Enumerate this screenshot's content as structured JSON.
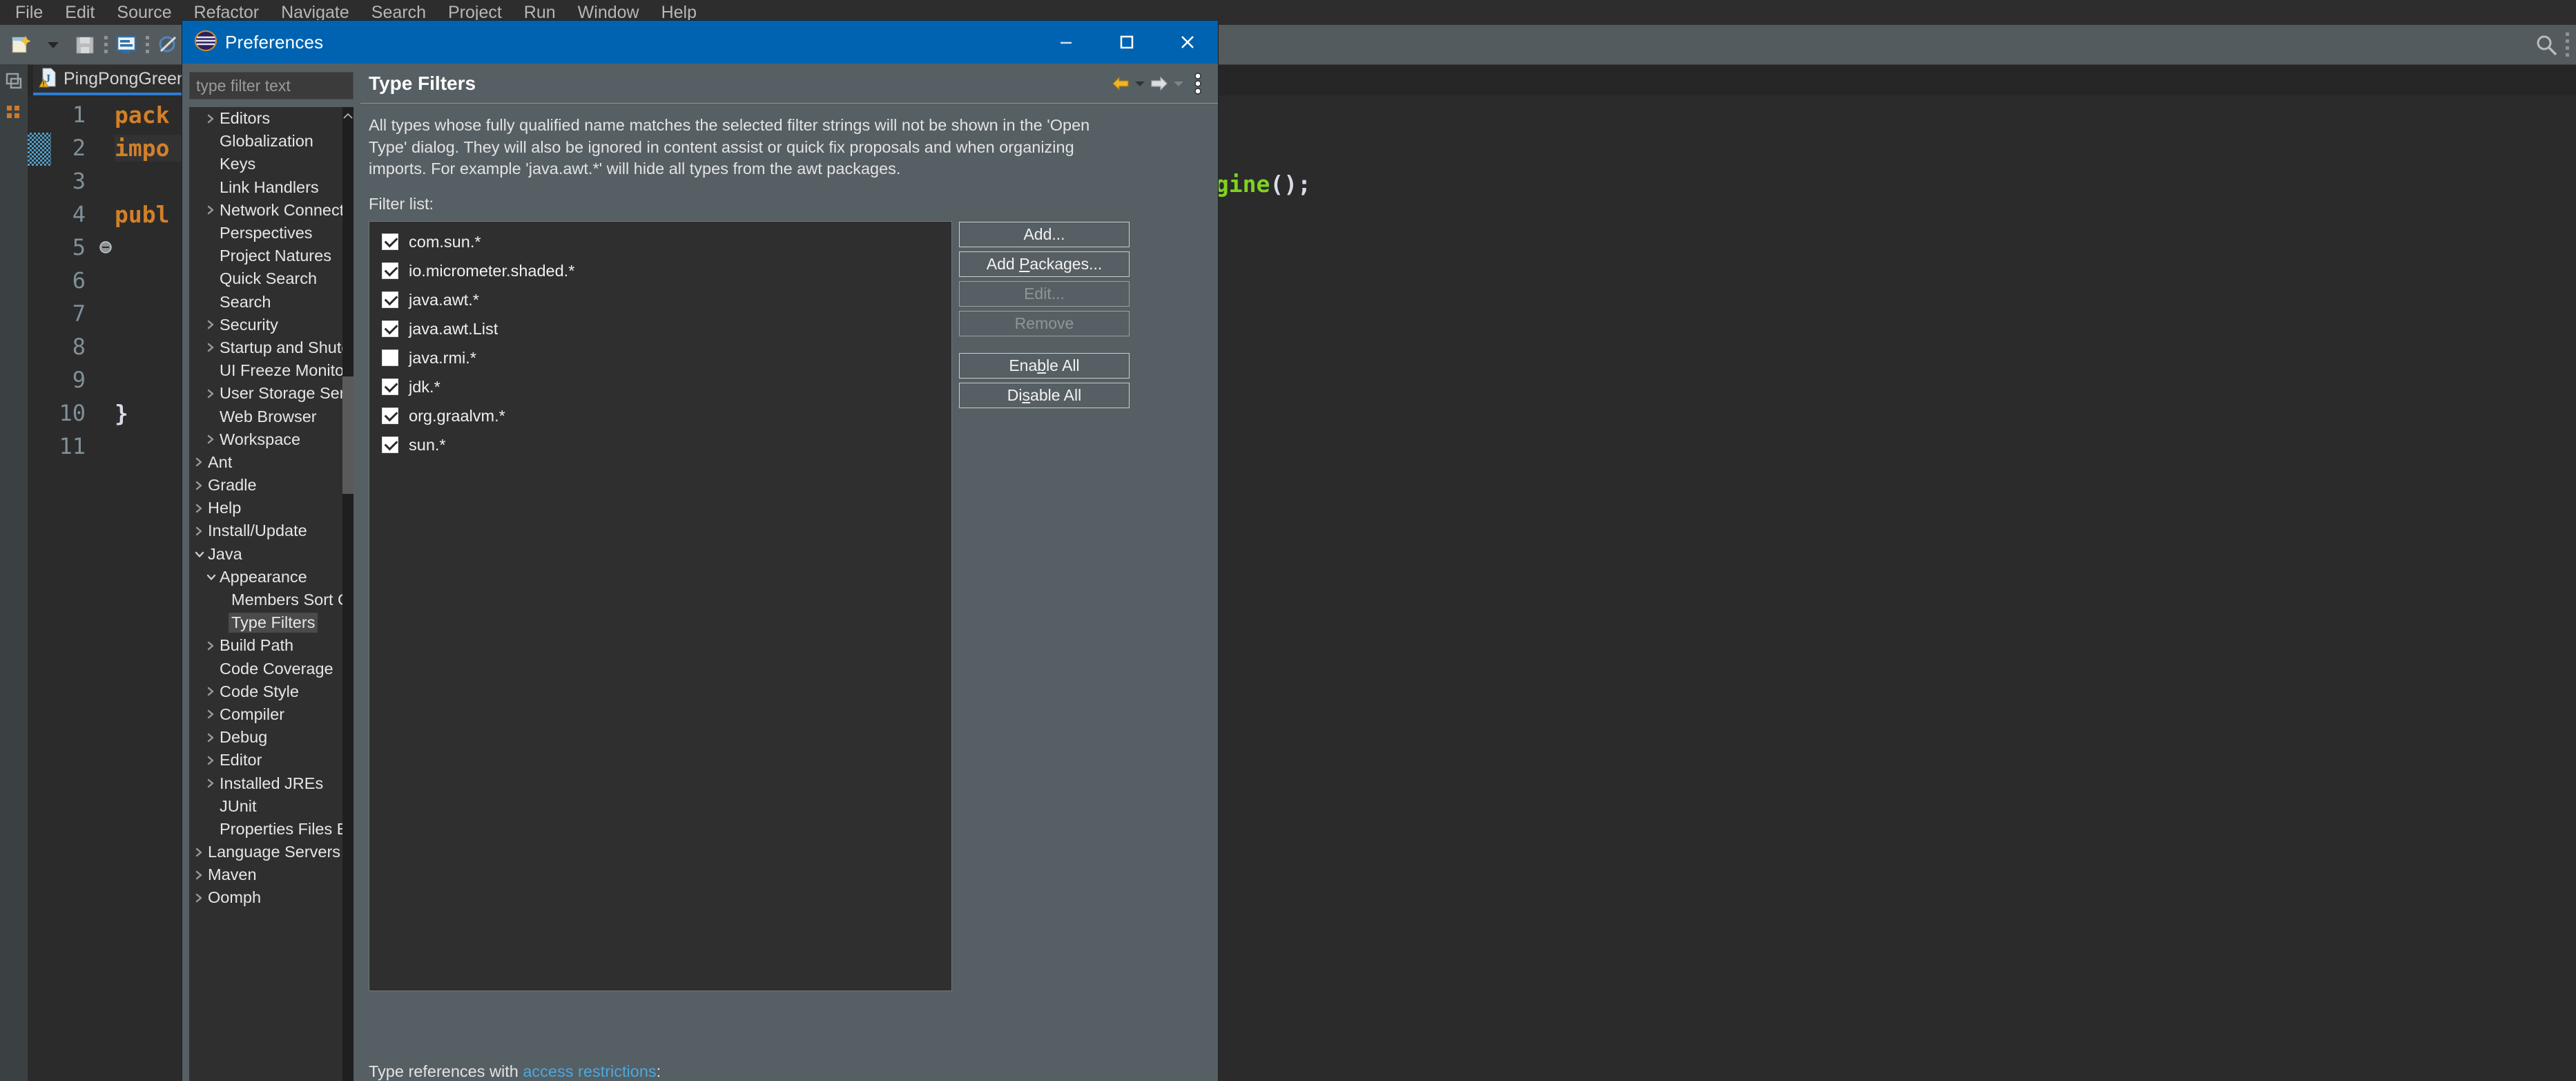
{
  "ide": {
    "menubar": [
      "File",
      "Edit",
      "Source",
      "Refactor",
      "Navigate",
      "Search",
      "Project",
      "Run",
      "Window",
      "Help"
    ],
    "toolbar_icons": [
      "new-wizard-icon",
      "dropdown-caret-icon",
      "save-icon",
      "toggle-mark-occurrences-icon",
      "skip-breakpoints-icon",
      "run-icon"
    ],
    "toolbar_right_icons": [
      "search-icon",
      "perspective-dots-icon"
    ],
    "rail_icons": [
      "restore-view-icon",
      "outline-icon"
    ],
    "editor": {
      "tab_label": "PingPongGreen",
      "tab_icon": "java-file-warning-icon",
      "lines": [
        {
          "no": "1",
          "text": "pack",
          "cls": "kw",
          "fold": "",
          "highlight": false
        },
        {
          "no": "2",
          "text": "impo",
          "cls": "kw",
          "fold": "",
          "highlight": true
        },
        {
          "no": "3",
          "text": "",
          "cls": "pun",
          "fold": "",
          "highlight": false
        },
        {
          "no": "4",
          "text": "publ",
          "cls": "kw",
          "fold": "",
          "highlight": false
        },
        {
          "no": "5",
          "text": "",
          "cls": "pun",
          "fold": "collapse-icon",
          "highlight": false
        },
        {
          "no": "6",
          "text": "",
          "cls": "pun",
          "fold": "",
          "highlight": false
        },
        {
          "no": "7",
          "text": "",
          "cls": "pun",
          "fold": "",
          "highlight": false
        },
        {
          "no": "8",
          "text": "",
          "cls": "pun",
          "fold": "",
          "highlight": false
        },
        {
          "no": "9",
          "text": "",
          "cls": "pun",
          "fold": "",
          "highlight": false
        },
        {
          "no": "10",
          "text": "}",
          "cls": "pun",
          "fold": "",
          "highlight": false
        },
        {
          "no": "11",
          "text": "",
          "cls": "pun",
          "fold": "",
          "highlight": false
        }
      ],
      "right_snippet_method": "ngine",
      "right_snippet_punct": "();"
    }
  },
  "dialog": {
    "title": "Preferences",
    "title_icon": "eclipse-logo-icon",
    "window_buttons": [
      {
        "name": "minimize-button",
        "glyph": "─"
      },
      {
        "name": "maximize-button",
        "glyph": "☐"
      },
      {
        "name": "close-button",
        "glyph": "✕"
      }
    ],
    "filter": {
      "placeholder": "type filter text",
      "value": ""
    },
    "tree": [
      {
        "label": "Editors",
        "indent": 1,
        "arrow": "collapsed",
        "selected": false
      },
      {
        "label": "Globalization",
        "indent": 1,
        "arrow": "none",
        "selected": false
      },
      {
        "label": "Keys",
        "indent": 1,
        "arrow": "none",
        "selected": false
      },
      {
        "label": "Link Handlers",
        "indent": 1,
        "arrow": "none",
        "selected": false
      },
      {
        "label": "Network Connections",
        "indent": 1,
        "arrow": "collapsed",
        "selected": false
      },
      {
        "label": "Perspectives",
        "indent": 1,
        "arrow": "none",
        "selected": false
      },
      {
        "label": "Project Natures",
        "indent": 1,
        "arrow": "none",
        "selected": false
      },
      {
        "label": "Quick Search",
        "indent": 1,
        "arrow": "none",
        "selected": false
      },
      {
        "label": "Search",
        "indent": 1,
        "arrow": "none",
        "selected": false
      },
      {
        "label": "Security",
        "indent": 1,
        "arrow": "collapsed",
        "selected": false
      },
      {
        "label": "Startup and Shutdown",
        "indent": 1,
        "arrow": "collapsed",
        "selected": false
      },
      {
        "label": "UI Freeze Monitoring",
        "indent": 1,
        "arrow": "none",
        "selected": false
      },
      {
        "label": "User Storage Service",
        "indent": 1,
        "arrow": "collapsed",
        "selected": false
      },
      {
        "label": "Web Browser",
        "indent": 1,
        "arrow": "none",
        "selected": false
      },
      {
        "label": "Workspace",
        "indent": 1,
        "arrow": "collapsed",
        "selected": false
      },
      {
        "label": "Ant",
        "indent": 0,
        "arrow": "collapsed",
        "selected": false
      },
      {
        "label": "Gradle",
        "indent": 0,
        "arrow": "collapsed",
        "selected": false
      },
      {
        "label": "Help",
        "indent": 0,
        "arrow": "collapsed",
        "selected": false
      },
      {
        "label": "Install/Update",
        "indent": 0,
        "arrow": "collapsed",
        "selected": false
      },
      {
        "label": "Java",
        "indent": 0,
        "arrow": "expanded",
        "selected": false
      },
      {
        "label": "Appearance",
        "indent": 1,
        "arrow": "expanded",
        "selected": false
      },
      {
        "label": "Members Sort Order",
        "indent": 2,
        "arrow": "none",
        "selected": false
      },
      {
        "label": "Type Filters",
        "indent": 2,
        "arrow": "none",
        "selected": true
      },
      {
        "label": "Build Path",
        "indent": 1,
        "arrow": "collapsed",
        "selected": false
      },
      {
        "label": "Code Coverage",
        "indent": 1,
        "arrow": "none",
        "selected": false
      },
      {
        "label": "Code Style",
        "indent": 1,
        "arrow": "collapsed",
        "selected": false
      },
      {
        "label": "Compiler",
        "indent": 1,
        "arrow": "collapsed",
        "selected": false
      },
      {
        "label": "Debug",
        "indent": 1,
        "arrow": "collapsed",
        "selected": false
      },
      {
        "label": "Editor",
        "indent": 1,
        "arrow": "collapsed",
        "selected": false
      },
      {
        "label": "Installed JREs",
        "indent": 1,
        "arrow": "collapsed",
        "selected": false
      },
      {
        "label": "JUnit",
        "indent": 1,
        "arrow": "none",
        "selected": false
      },
      {
        "label": "Properties Files Editor",
        "indent": 1,
        "arrow": "none",
        "selected": false
      },
      {
        "label": "Language Servers",
        "indent": 0,
        "arrow": "collapsed",
        "selected": false
      },
      {
        "label": "Maven",
        "indent": 0,
        "arrow": "collapsed",
        "selected": false
      },
      {
        "label": "Oomph",
        "indent": 0,
        "arrow": "collapsed",
        "selected": false
      }
    ],
    "page": {
      "title": "Type Filters",
      "head_icons": [
        "back-arrow-icon",
        "back-dropdown-caret-icon",
        "forward-arrow-icon",
        "forward-dropdown-caret-icon",
        "view-menu-icon"
      ],
      "description": "All types whose fully qualified name matches the selected filter strings will not be shown in the 'Open Type' dialog. They will also be ignored in content assist or quick fix proposals and when organizing imports. For example 'java.awt.*' will hide all types from the awt packages.",
      "filter_list_label": "Filter list:",
      "filter_items": [
        {
          "label": "com.sun.*",
          "checked": true
        },
        {
          "label": "io.micrometer.shaded.*",
          "checked": true
        },
        {
          "label": "java.awt.*",
          "checked": true
        },
        {
          "label": "java.awt.List",
          "checked": true
        },
        {
          "label": "java.rmi.*",
          "checked": false
        },
        {
          "label": "jdk.*",
          "checked": true
        },
        {
          "label": "org.graalvm.*",
          "checked": true
        },
        {
          "label": "sun.*",
          "checked": true
        }
      ],
      "buttons": [
        {
          "name": "add-button",
          "label": "Add...",
          "disabled": false,
          "mnemonic": ""
        },
        {
          "name": "add-packages-button",
          "label": "Add Packages...",
          "disabled": false,
          "mnemonic": "P"
        },
        {
          "name": "edit-button",
          "label": "Edit...",
          "disabled": true,
          "mnemonic": ""
        },
        {
          "name": "remove-button",
          "label": "Remove",
          "disabled": true,
          "mnemonic": ""
        },
        {
          "name": "enable-all-button",
          "label": "Enable All",
          "disabled": false,
          "mnemonic": "b"
        },
        {
          "name": "disable-all-button",
          "label": "Disable All",
          "disabled": false,
          "mnemonic": "s"
        }
      ],
      "bottom_note_prefix": "Type references with ",
      "bottom_note_link": "access restrictions",
      "bottom_note_suffix": ":"
    }
  },
  "colors": {
    "title_bar": "#0063b1",
    "dialog_bg": "#565f63",
    "tree_bg": "#2f2f2f",
    "accent_link": "#4aa8e0",
    "editor_keyword": "#d2802a",
    "editor_method": "#7ed321"
  }
}
